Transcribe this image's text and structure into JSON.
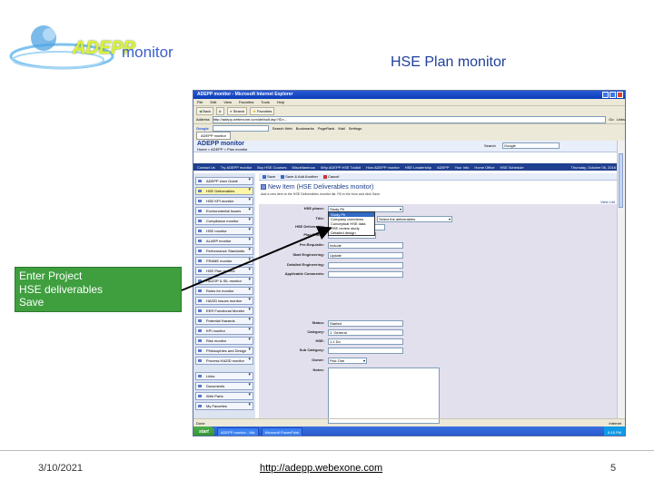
{
  "slide": {
    "logo_word": "ADEPP",
    "logo_suffix": "monitor",
    "title": "HSE Plan monitor",
    "callout": [
      "Enter Project",
      "HSE deliverables",
      "Save"
    ],
    "footer_date": "3/10/2021",
    "footer_url": "http://adepp.webexone.com",
    "page_number": "5"
  },
  "browser": {
    "window_title": "ADEPP monitor - Microsoft Internet Explorer",
    "menu": [
      "File",
      "Edit",
      "View",
      "Favorites",
      "Tools",
      "Help"
    ],
    "toolbar": [
      "Back",
      "Search",
      "Favorites"
    ],
    "address_label": "Address",
    "address": "http://adepp.webexone.com/default.asp?ID=...",
    "go_label": "Go",
    "links_label": "Links",
    "google_label": "Google",
    "google_search": "Search Web",
    "google_tools": [
      "Bookmarks",
      "PageRank",
      "Mail",
      "Settings"
    ],
    "tab_label": "ADEPP monitor",
    "status_left": "Done",
    "status_right": "Internet",
    "start_label": "start",
    "tasks": [
      "ADEPP monitor - Mic",
      "Microsoft PowerPoint"
    ],
    "clock": "8:18 PM"
  },
  "site": {
    "title": "ADEPP monitor",
    "subtitle": "Home > ADEPP > Plan monitor",
    "search_label": "Search",
    "search_value": "Google",
    "nav": [
      "Contact Us",
      "Try ADEPP monitor",
      "Buy HSE Courses",
      "Miscellaneous",
      "Why ADEPP HSE Toolkit",
      "How ADEPP monitor",
      "HSE Leadership",
      "ADEPP",
      "Your Info",
      "Home Office",
      "HSE Schedule"
    ],
    "nav_date": "Thursday, October 06, 2016",
    "sidebar": [
      "ADEPP User Guide",
      "HSE Deliverables",
      "HSE KPI monitor",
      "Environmental Issues",
      "Compliance monitor",
      "HSE monitor",
      "ALARP monitor",
      "Performance Standards",
      "FRAME monitor",
      "HSE Plan monitor",
      "HAZOP & SIL monitor",
      "Rules for monitor",
      "HAZID Issues monitor",
      "EER Functional Monitor",
      "Potential Hazards",
      "KPI monitor",
      "Risk monitor",
      "Philosophies and Design",
      "Process HAZID monitor",
      "Links",
      "Documents",
      "Web Parts",
      "My Favorites"
    ],
    "sidebar_selected_index": 1,
    "form_toolbar": [
      "Save",
      "Save & Add Another",
      "Cancel"
    ],
    "form_title": "New Item (HSE Deliverables monitor)",
    "form_hint": "Add a new item to the HSE Deliverables monitor list. Fill in the form and click Save.",
    "view_link": "View List",
    "fields": [
      {
        "label": "HSE phase:",
        "value": "Study Ph"
      },
      {
        "label": "Title:",
        "value": "Select the deliverables"
      },
      {
        "label": "HSE Deliverable:",
        "value": ""
      },
      {
        "label": "Plan Phase:",
        "value": ""
      },
      {
        "label": "Pre-Requisite:",
        "value": "Include"
      },
      {
        "label": "Start Engineering:",
        "value": "Update"
      },
      {
        "label": "Detailed Engineering:",
        "value": ""
      },
      {
        "label": "Applicable Comments:",
        "value": ""
      },
      {
        "label": "Status:",
        "value": "Started"
      },
      {
        "label": "Category:",
        "value": "1. General"
      },
      {
        "label": "HSE:",
        "value": "1.1 Do"
      },
      {
        "label": "Sub Category:",
        "value": ""
      },
      {
        "label": "Owner:",
        "value": "Pick One"
      },
      {
        "label": "Notes:",
        "value": ""
      }
    ],
    "dropdown_options": [
      "Study Ph",
      "Company overviews",
      "Conceptual HSE data",
      "HSE review study",
      "Detailed design"
    ]
  }
}
